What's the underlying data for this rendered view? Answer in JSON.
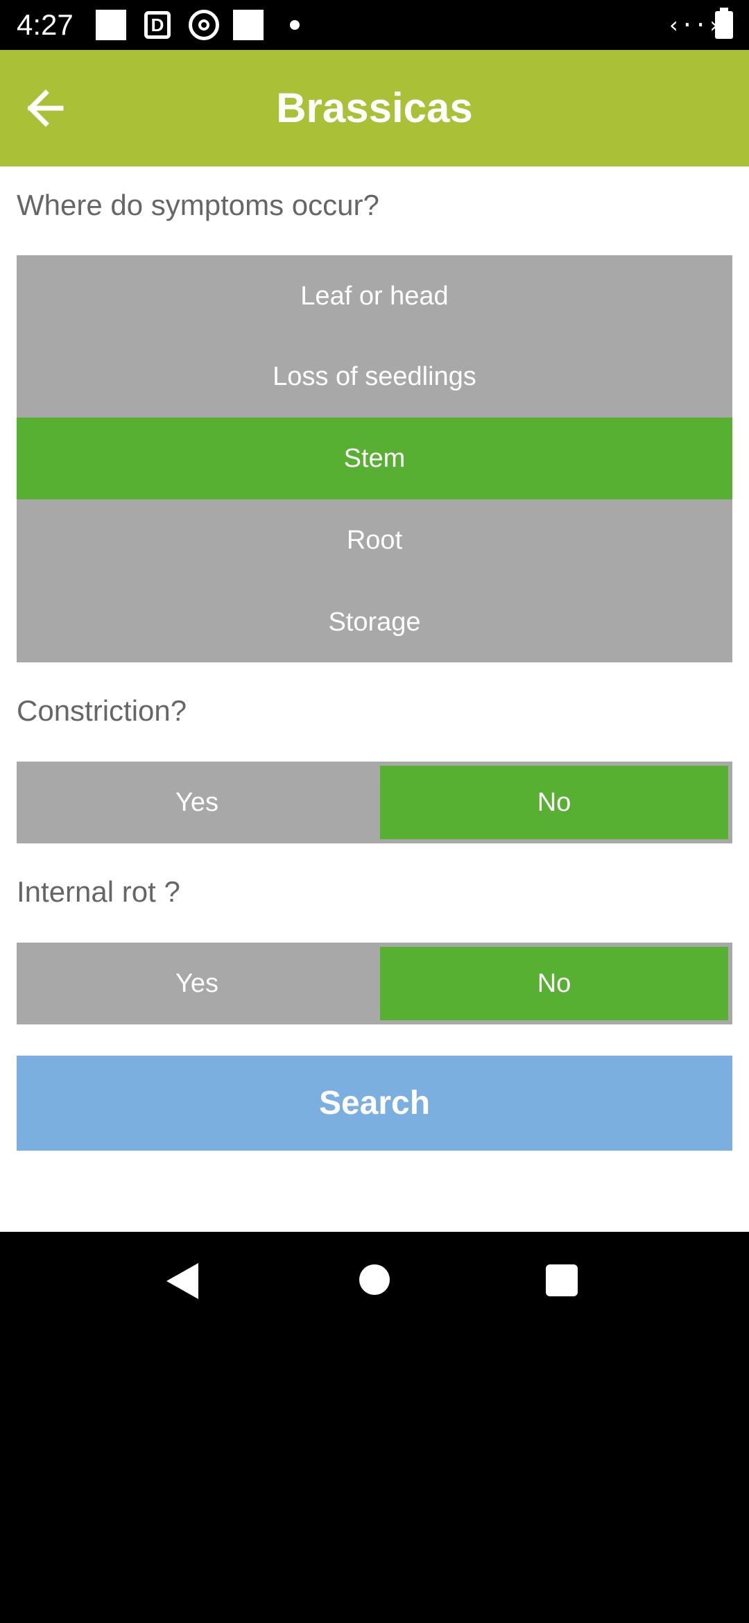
{
  "status_bar": {
    "time": "4:27",
    "icons": [
      "notification-square-icon",
      "d-app-icon",
      "target-app-icon",
      "notification-square-icon",
      "dot-icon",
      "signal-icon",
      "battery-icon"
    ]
  },
  "app_bar": {
    "title": "Brassicas",
    "back_icon": "arrow-left-icon"
  },
  "questions": {
    "location": {
      "label": "Where do symptoms occur?",
      "options": [
        {
          "label": "Leaf or head",
          "selected": false
        },
        {
          "label": "Loss of seedlings",
          "selected": false
        },
        {
          "label": "Stem",
          "selected": true
        },
        {
          "label": "Root",
          "selected": false
        },
        {
          "label": "Storage",
          "selected": false
        }
      ]
    },
    "constriction": {
      "label": "Constriction?",
      "yes_label": "Yes",
      "no_label": "No",
      "selected": "No"
    },
    "internal_rot": {
      "label": "Internal rot ?",
      "yes_label": "Yes",
      "no_label": "No",
      "selected": "No"
    }
  },
  "search_button": {
    "label": "Search"
  },
  "nav_bar": {
    "icons": [
      "back-triangle-icon",
      "home-circle-icon",
      "recent-square-icon"
    ]
  },
  "colors": {
    "app_bar": "#a9c037",
    "selected": "#58b033",
    "unselected": "#a8a8a8",
    "search": "#7aafe0",
    "question_text": "#666666"
  }
}
